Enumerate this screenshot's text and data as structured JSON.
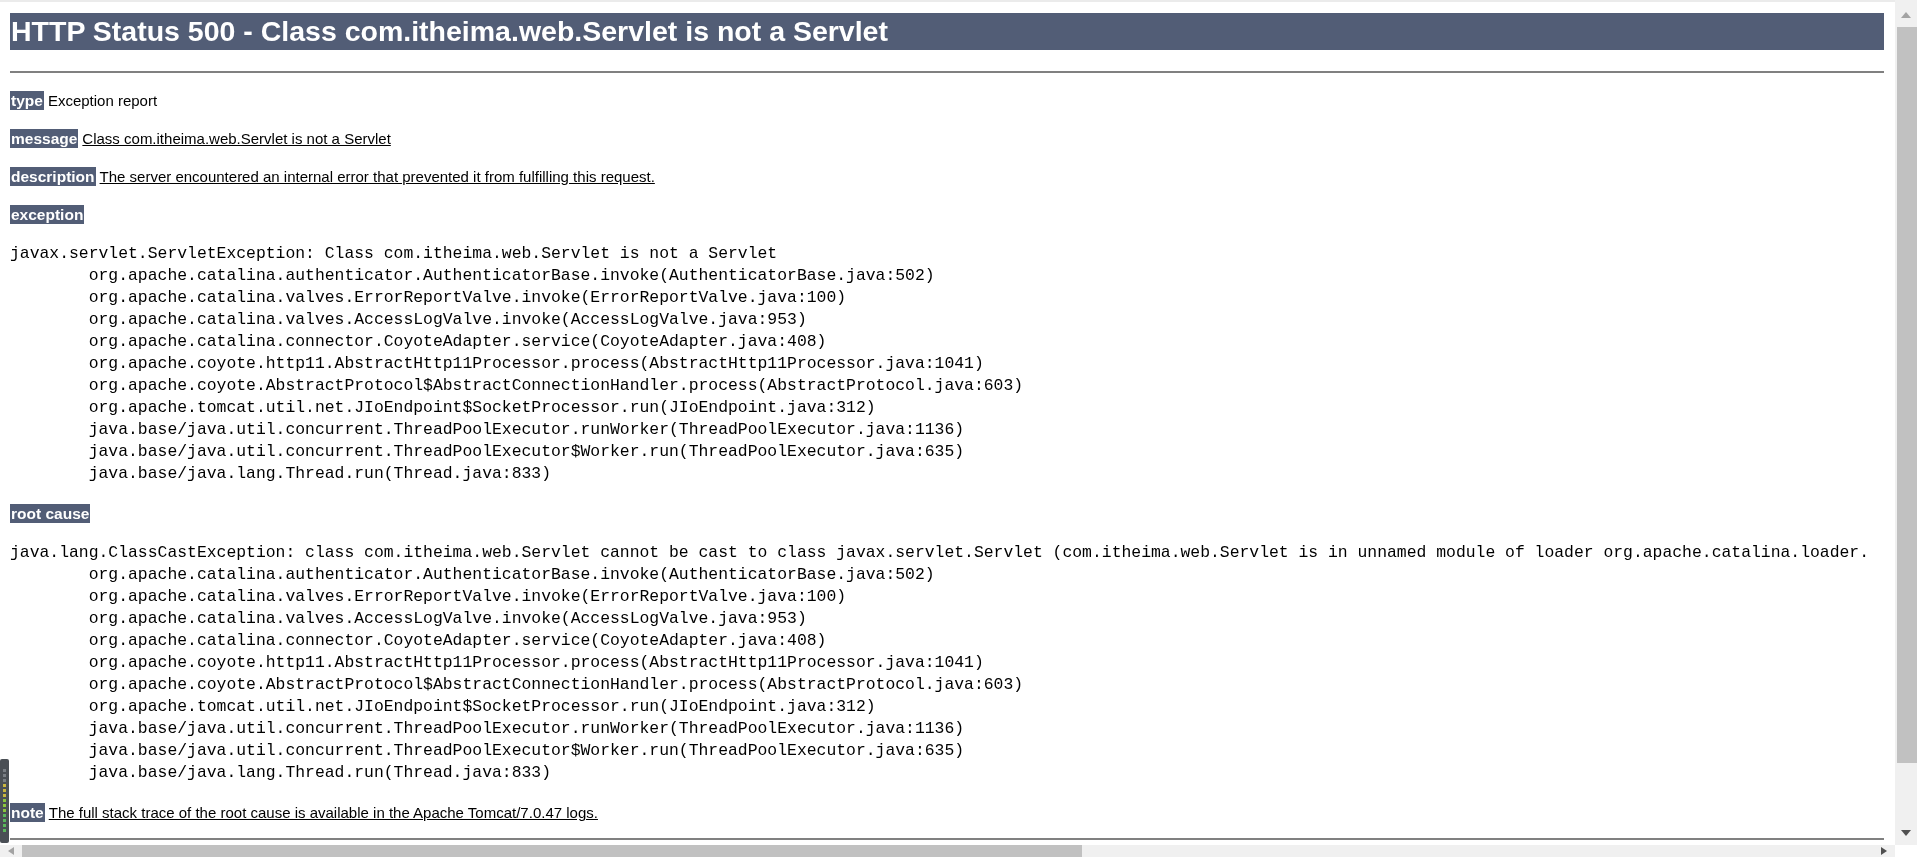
{
  "heading": "HTTP Status 500 - Class com.itheima.web.Servlet is not a Servlet",
  "sections": [
    {
      "kind": "field",
      "label": "type",
      "value": "Exception report",
      "underlined": false
    },
    {
      "kind": "field",
      "label": "message",
      "value": "Class com.itheima.web.Servlet is not a Servlet",
      "underlined": true
    },
    {
      "kind": "field",
      "label": "description",
      "value": "The server encountered an internal error that prevented it from fulfilling this request.",
      "underlined": true
    },
    {
      "kind": "trace",
      "label": "exception",
      "head": "javax.servlet.ServletException: Class com.itheima.web.Servlet is not a Servlet",
      "frames": [
        "org.apache.catalina.authenticator.AuthenticatorBase.invoke(AuthenticatorBase.java:502)",
        "org.apache.catalina.valves.ErrorReportValve.invoke(ErrorReportValve.java:100)",
        "org.apache.catalina.valves.AccessLogValve.invoke(AccessLogValve.java:953)",
        "org.apache.catalina.connector.CoyoteAdapter.service(CoyoteAdapter.java:408)",
        "org.apache.coyote.http11.AbstractHttp11Processor.process(AbstractHttp11Processor.java:1041)",
        "org.apache.coyote.AbstractProtocol$AbstractConnectionHandler.process(AbstractProtocol.java:603)",
        "org.apache.tomcat.util.net.JIoEndpoint$SocketProcessor.run(JIoEndpoint.java:312)",
        "java.base/java.util.concurrent.ThreadPoolExecutor.runWorker(ThreadPoolExecutor.java:1136)",
        "java.base/java.util.concurrent.ThreadPoolExecutor$Worker.run(ThreadPoolExecutor.java:635)",
        "java.base/java.lang.Thread.run(Thread.java:833)"
      ]
    },
    {
      "kind": "trace",
      "label": "root cause",
      "head": "java.lang.ClassCastException: class com.itheima.web.Servlet cannot be cast to class javax.servlet.Servlet (com.itheima.web.Servlet is in unnamed module of loader org.apache.catalina.loader.",
      "frames": [
        "org.apache.catalina.authenticator.AuthenticatorBase.invoke(AuthenticatorBase.java:502)",
        "org.apache.catalina.valves.ErrorReportValve.invoke(ErrorReportValve.java:100)",
        "org.apache.catalina.valves.AccessLogValve.invoke(AccessLogValve.java:953)",
        "org.apache.catalina.connector.CoyoteAdapter.service(CoyoteAdapter.java:408)",
        "org.apache.coyote.http11.AbstractHttp11Processor.process(AbstractHttp11Processor.java:1041)",
        "org.apache.coyote.AbstractProtocol$AbstractConnectionHandler.process(AbstractProtocol.java:603)",
        "org.apache.tomcat.util.net.JIoEndpoint$SocketProcessor.run(JIoEndpoint.java:312)",
        "java.base/java.util.concurrent.ThreadPoolExecutor.runWorker(ThreadPoolExecutor.java:1136)",
        "java.base/java.util.concurrent.ThreadPoolExecutor$Worker.run(ThreadPoolExecutor.java:635)",
        "java.base/java.lang.Thread.run(Thread.java:833)"
      ]
    },
    {
      "kind": "field",
      "label": "note",
      "value": "The full stack trace of the root cause is available in the Apache Tomcat/7.0.47 logs.",
      "underlined": true
    }
  ]
}
